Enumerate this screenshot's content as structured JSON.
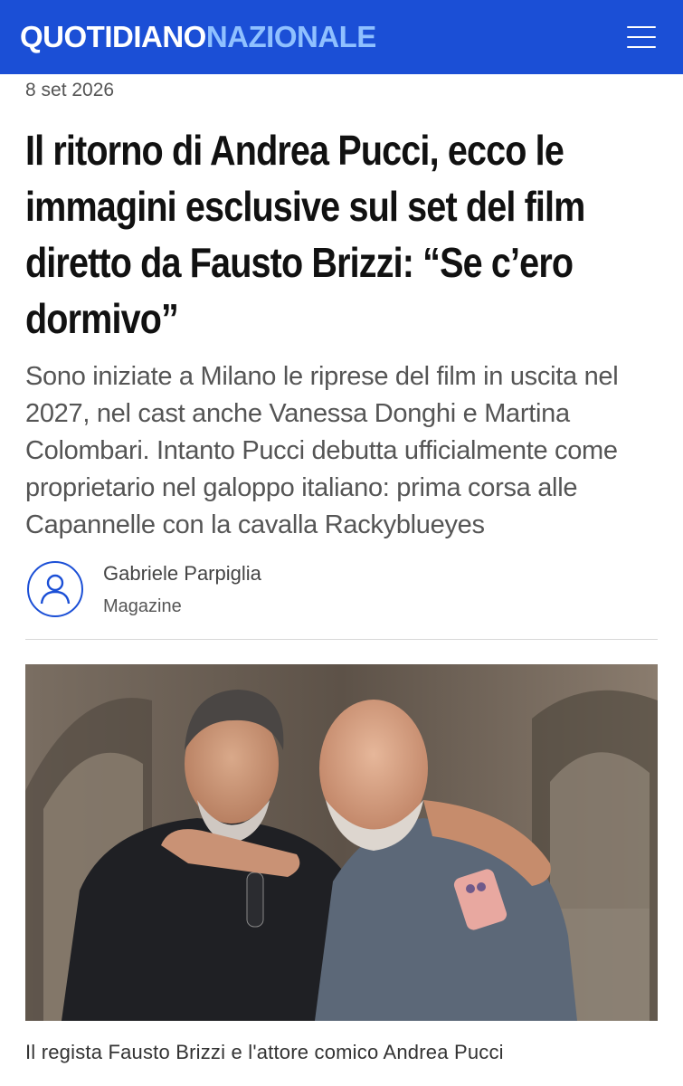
{
  "header": {
    "logo_part1": "QUOTIDIANO",
    "logo_part2": "NAZIONALE",
    "menu_icon": "hamburger-menu-icon",
    "brand_color": "#1b4fd6",
    "logo_accent_color": "#8fc0ff"
  },
  "article": {
    "date": "8 set 2026",
    "headline": "Il ritorno di Andrea Pucci, ecco le immagini esclusive sul set del film diretto da Fausto Brizzi: “Se c’ero dormivo”",
    "subtitle": "Sono iniziate a Milano le riprese del film in uscita nel 2027, nel cast anche Vanessa Donghi e Martina Colombari. Intanto Pucci debutta ufficialmente come proprietario nel galoppo italiano: prima corsa alle Capannelle con la cavalla Rackyblueyes",
    "author": {
      "name": "Gabriele Parpiglia",
      "section": "Magazine",
      "avatar_icon": "user-avatar-icon"
    },
    "image": {
      "caption": "Il regista Fausto Brizzi e l'attore comico Andrea Pucci"
    }
  }
}
